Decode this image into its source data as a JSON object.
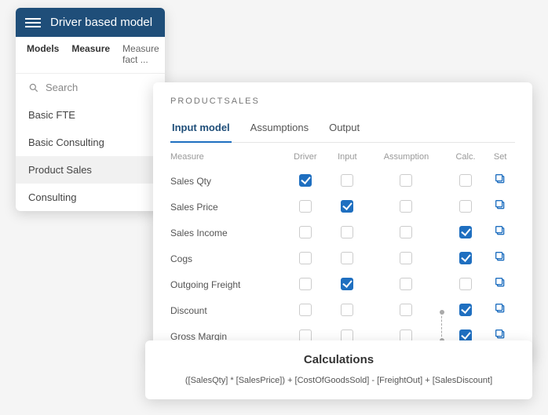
{
  "app": {
    "title": "Driver based model"
  },
  "breadcrumb": {
    "a": "Models",
    "b": "Measure",
    "c": "Measure fact ..."
  },
  "search": {
    "placeholder": "Search"
  },
  "sidebar": {
    "items": [
      {
        "label": "Basic FTE"
      },
      {
        "label": "Basic Consulting"
      },
      {
        "label": "Product Sales"
      },
      {
        "label": "Consulting"
      }
    ]
  },
  "main": {
    "title": "PRODUCTSALES",
    "tabs": {
      "a": "Input model",
      "b": "Assumptions",
      "c": "Output"
    },
    "cols": {
      "measure": "Measure",
      "driver": "Driver",
      "input": "Input",
      "assumption": "Assumption",
      "calc": "Calc.",
      "set": "Set"
    },
    "rows": [
      {
        "label": "Sales Qty",
        "driver": true,
        "input": false,
        "assumption": false,
        "calc": false
      },
      {
        "label": "Sales Price",
        "driver": false,
        "input": true,
        "assumption": false,
        "calc": false
      },
      {
        "label": "Sales Income",
        "driver": false,
        "input": false,
        "assumption": false,
        "calc": true
      },
      {
        "label": "Cogs",
        "driver": false,
        "input": false,
        "assumption": false,
        "calc": true
      },
      {
        "label": "Outgoing Freight",
        "driver": false,
        "input": true,
        "assumption": false,
        "calc": false
      },
      {
        "label": "Discount",
        "driver": false,
        "input": false,
        "assumption": false,
        "calc": true
      },
      {
        "label": "Gross Margin",
        "driver": false,
        "input": false,
        "assumption": false,
        "calc": true
      }
    ]
  },
  "calc": {
    "title": "Calculations",
    "formula": "([SalesQty] * [SalesPrice]) + [CostOfGoodsSold] - [FreightOut] + [SalesDiscount]"
  }
}
